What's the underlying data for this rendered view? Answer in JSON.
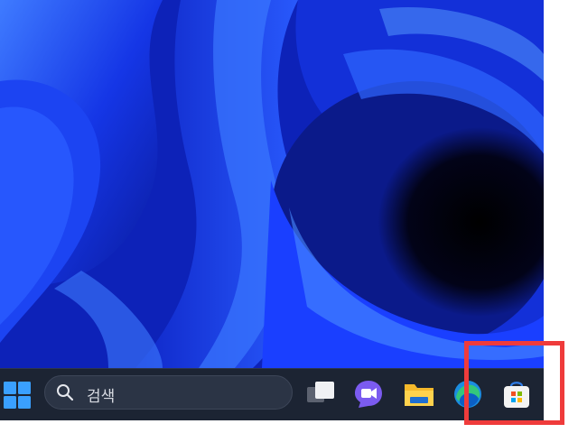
{
  "desktop": {
    "wallpaper": "windows-11-bloom-wallpaper"
  },
  "taskbar": {
    "start_icon": "windows-start-icon",
    "search": {
      "placeholder": "검색",
      "icon": "search-icon"
    },
    "apps": [
      {
        "name": "task-view",
        "icon": "task-view-icon"
      },
      {
        "name": "chat",
        "icon": "chat-icon"
      },
      {
        "name": "file-explorer",
        "icon": "file-explorer-icon"
      },
      {
        "name": "edge",
        "icon": "edge-icon"
      },
      {
        "name": "microsoft-store",
        "icon": "store-icon"
      }
    ]
  },
  "annotation": {
    "highlight_color": "#ef3b3b",
    "target": "microsoft-store"
  },
  "colors": {
    "taskbar_bg": "#1c2433",
    "wallpaper_blue": "#1a3cff",
    "accent_blue": "#3aa0ff"
  }
}
